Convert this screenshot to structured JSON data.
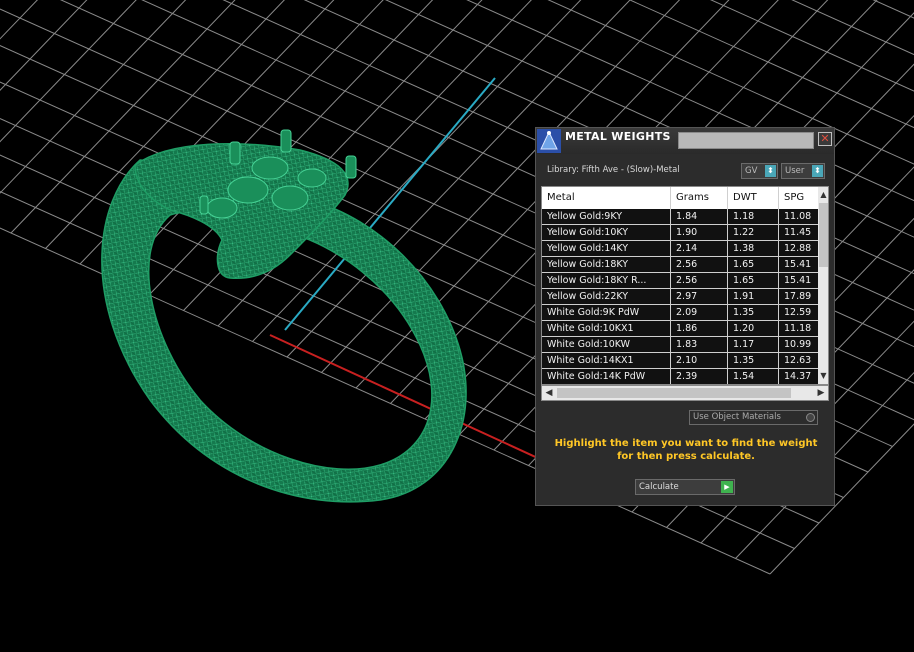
{
  "colors": {
    "ring": "#1c8a5a",
    "ring_light": "#37c084",
    "grid": "#9a9a9a",
    "x_axis": "#c82020",
    "y_axis": "#2aaac4",
    "accent": "#ffc726"
  },
  "viewport": {
    "object": "ring-wireframe"
  },
  "dialog": {
    "title": "METAL WEIGHTS",
    "close_glyph": "✕",
    "library_label": "Library: Fifth Ave - (Slow)-Metal",
    "dropdown_gv": "GV",
    "dropdown_user": "User",
    "columns": [
      "Metal",
      "Grams",
      "DWT",
      "SPG"
    ],
    "rows": [
      [
        "Yellow Gold:9KY",
        "1.84",
        "1.18",
        "11.08"
      ],
      [
        "Yellow Gold:10KY",
        "1.90",
        "1.22",
        "11.45"
      ],
      [
        "Yellow Gold:14KY",
        "2.14",
        "1.38",
        "12.88"
      ],
      [
        "Yellow Gold:18KY",
        "2.56",
        "1.65",
        "15.41"
      ],
      [
        "Yellow Gold:18KY R...",
        "2.56",
        "1.65",
        "15.41"
      ],
      [
        "Yellow Gold:22KY",
        "2.97",
        "1.91",
        "17.89"
      ],
      [
        "White Gold:9K PdW",
        "2.09",
        "1.35",
        "12.59"
      ],
      [
        "White Gold:10KX1",
        "1.86",
        "1.20",
        "11.18"
      ],
      [
        "White Gold:10KW",
        "1.83",
        "1.17",
        "10.99"
      ],
      [
        "White Gold:14KX1",
        "2.10",
        "1.35",
        "12.63"
      ],
      [
        "White Gold:14K PdW",
        "2.39",
        "1.54",
        "14.37"
      ]
    ],
    "use_object_materials": "Use Object Materials",
    "hint": "Highlight the item you want to find the weight for then press calculate.",
    "calculate_label": "Calculate"
  }
}
